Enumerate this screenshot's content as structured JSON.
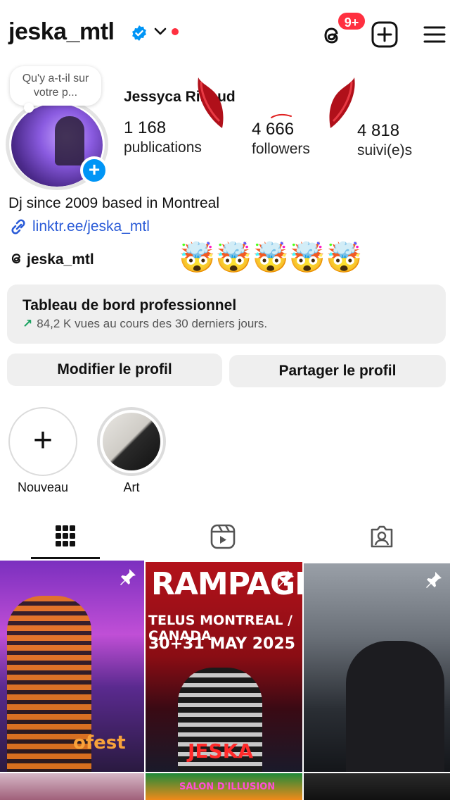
{
  "header": {
    "username": "jeska_mtl",
    "notifications_badge": "9+"
  },
  "profile": {
    "note": "Qu'y a-t-il sur votre p...",
    "full_name": "Jessyca Rinaud",
    "stats": [
      {
        "value": "1 168",
        "label": "publications"
      },
      {
        "value": "4 666",
        "label": "followers"
      },
      {
        "value": "4 818",
        "label": "suivi(e)s"
      }
    ],
    "bio": "Dj since 2009 based in Montreal",
    "link": "linktr.ee/jeska_mtl",
    "threads_handle": "jeska_mtl",
    "emojis": "🤯🤯🤯🤯🤯"
  },
  "dashboard": {
    "title": "Tableau de bord professionnel",
    "subtitle": "84,2 K vues au cours des 30 derniers jours."
  },
  "buttons": {
    "edit": "Modifier le profil",
    "share": "Partager le profil"
  },
  "highlights": [
    {
      "label": "Nouveau"
    },
    {
      "label": "Art"
    }
  ],
  "grid": {
    "post2_text_line1": "RAMPAGE",
    "post2_text_line2": "TELUS MONTREAL / CANADA",
    "post2_text_line3": "30+31 MAY 2025",
    "post2_text_line4": "JESKA",
    "post1_text": "ofest",
    "post5_text": "SALON D'ILLUSION"
  },
  "colors": {
    "accent_blue": "#0095f6",
    "badge_red": "#ff3040",
    "link_blue": "#2a5bd7"
  }
}
